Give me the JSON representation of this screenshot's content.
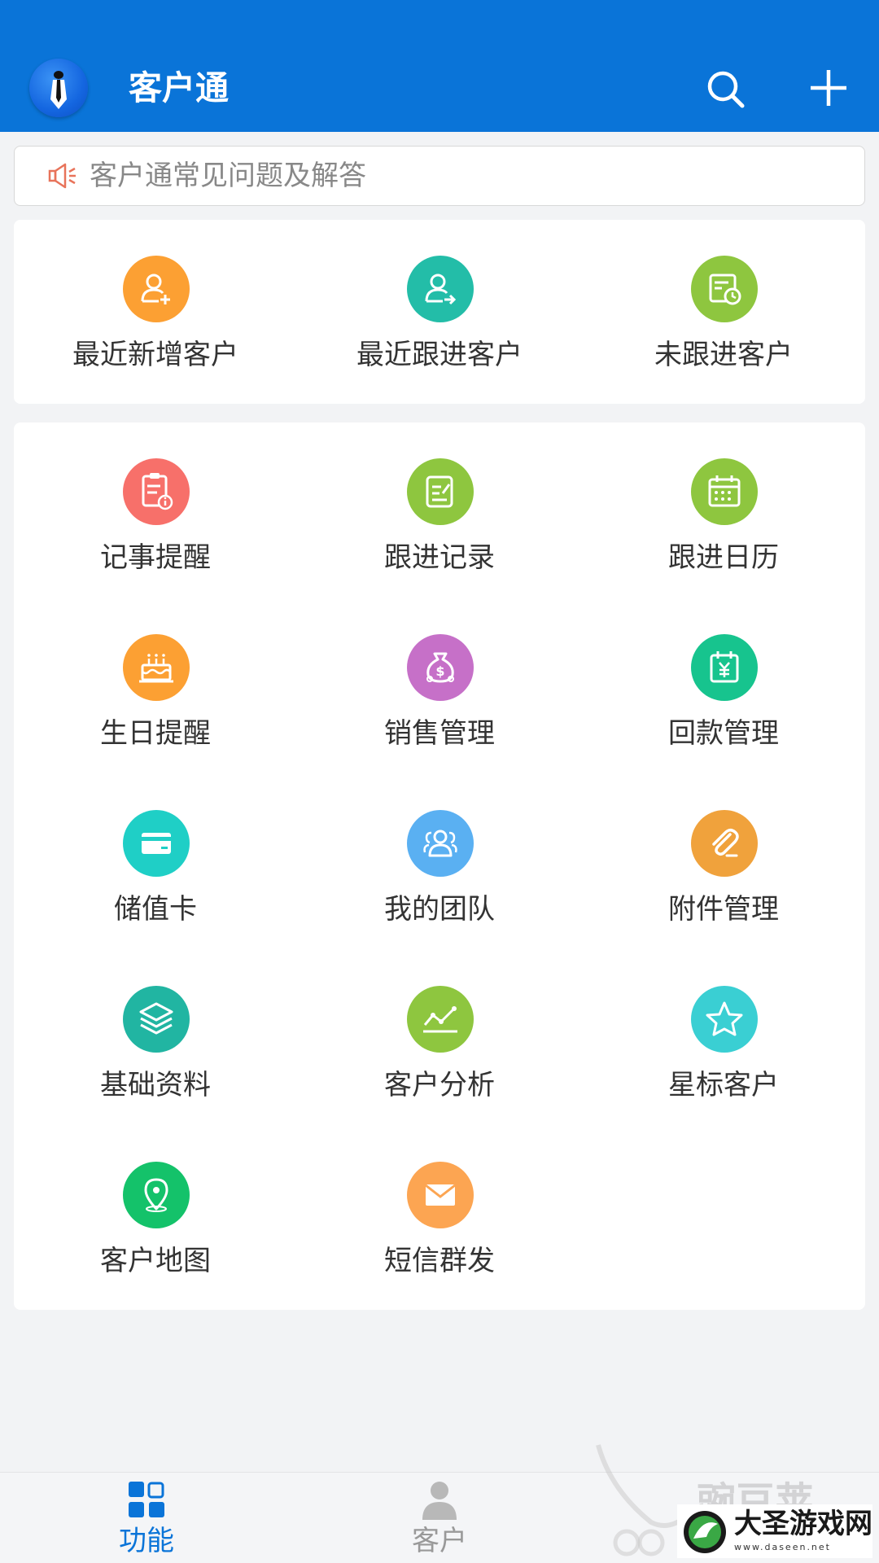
{
  "app": {
    "title": "客户通"
  },
  "notice": {
    "text": "客户通常见问题及解答"
  },
  "quick": [
    {
      "label": "最近新增客户",
      "icon": "user-add-icon",
      "color": "#fca033"
    },
    {
      "label": "最近跟进客户",
      "icon": "user-forward-icon",
      "color": "#23bda8"
    },
    {
      "label": "未跟进客户",
      "icon": "calendar-clock-icon",
      "color": "#8ec63f"
    }
  ],
  "features": [
    {
      "label": "记事提醒",
      "icon": "clipboard-info-icon",
      "color": "#f7706a"
    },
    {
      "label": "跟进记录",
      "icon": "edit-note-icon",
      "color": "#8ec63f"
    },
    {
      "label": "跟进日历",
      "icon": "calendar-icon",
      "color": "#8ec63f"
    },
    {
      "label": "生日提醒",
      "icon": "cake-icon",
      "color": "#fca033"
    },
    {
      "label": "销售管理",
      "icon": "money-bag-icon",
      "color": "#c670c8"
    },
    {
      "label": "回款管理",
      "icon": "yen-calendar-icon",
      "color": "#17c48e"
    },
    {
      "label": "储值卡",
      "icon": "card-icon",
      "color": "#1fcfc6"
    },
    {
      "label": "我的团队",
      "icon": "team-icon",
      "color": "#5ab0f2"
    },
    {
      "label": "附件管理",
      "icon": "paperclip-icon",
      "color": "#f0a23c"
    },
    {
      "label": "基础资料",
      "icon": "layers-icon",
      "color": "#21b5a2"
    },
    {
      "label": "客户分析",
      "icon": "line-chart-icon",
      "color": "#8ec63f"
    },
    {
      "label": "星标客户",
      "icon": "star-icon",
      "color": "#3acfd3"
    },
    {
      "label": "客户地图",
      "icon": "map-pin-icon",
      "color": "#14c26a"
    },
    {
      "label": "短信群发",
      "icon": "mail-icon",
      "color": "#fca552"
    }
  ],
  "nav": [
    {
      "label": "功能",
      "icon": "grid-icon",
      "active": true
    },
    {
      "label": "客户",
      "icon": "person-icon",
      "active": false
    }
  ],
  "watermark": {
    "text": "豌豆荚",
    "badge_title": "大圣游戏网",
    "badge_sub": "www.daseen.net"
  },
  "colors": {
    "primary": "#0a74d8",
    "background": "#f2f3f5",
    "inactive": "#999999"
  }
}
